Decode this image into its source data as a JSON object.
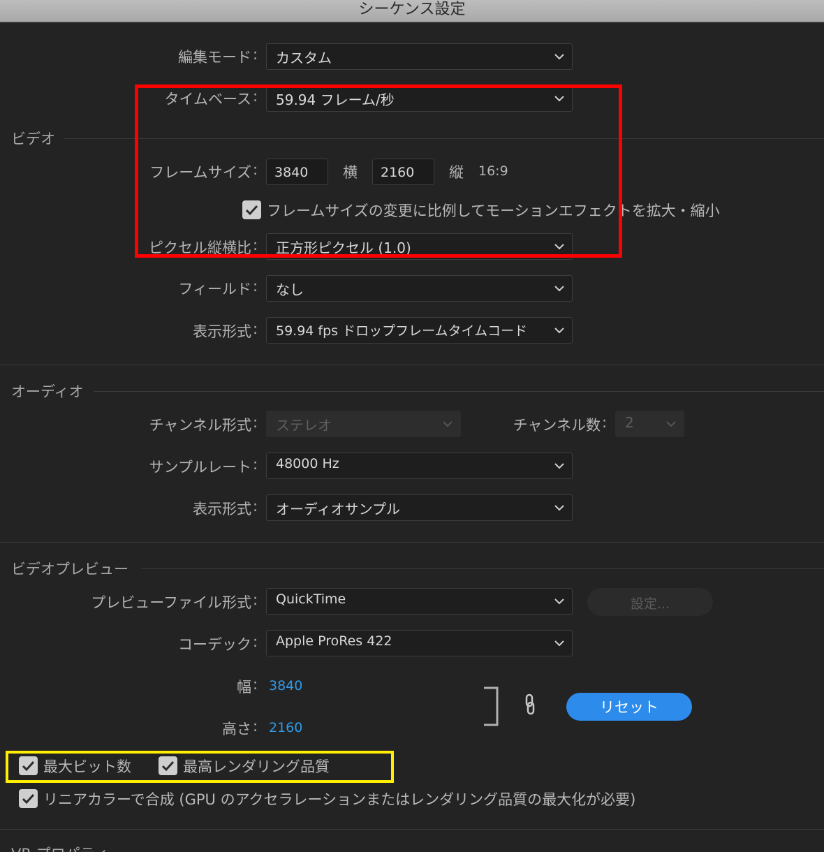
{
  "window": {
    "title": "シーケンス設定"
  },
  "edit_mode": {
    "label": "編集モード",
    "value": "カスタム"
  },
  "timebase": {
    "label": "タイムベース",
    "value": "59.94  フレーム/秒"
  },
  "video": {
    "section_title": "ビデオ",
    "frame_size": {
      "label": "フレームサイズ",
      "width": "3840",
      "width_label": "横",
      "height": "2160",
      "height_label": "縦",
      "aspect": "16:9"
    },
    "scale_motion": {
      "label": "フレームサイズの変更に比例してモーションエフェクトを拡大・縮小",
      "checked": true
    },
    "pixel_aspect": {
      "label": "ピクセル縦横比",
      "value": "正方形ピクセル (1.0)"
    },
    "fields": {
      "label": "フィールド",
      "value": "なし"
    },
    "display_format": {
      "label": "表示形式",
      "value": "59.94 fps ドロップフレームタイムコード"
    }
  },
  "audio": {
    "section_title": "オーディオ",
    "channel_format": {
      "label": "チャンネル形式",
      "value": "ステレオ"
    },
    "channel_count": {
      "label": "チャンネル数",
      "value": "2"
    },
    "sample_rate": {
      "label": "サンプルレート",
      "value": "48000 Hz"
    },
    "display_format": {
      "label": "表示形式",
      "value": "オーディオサンプル"
    }
  },
  "video_preview": {
    "section_title": "ビデオプレビュー",
    "file_format": {
      "label": "プレビューファイル形式",
      "value": "QuickTime"
    },
    "settings_button": "設定...",
    "codec": {
      "label": "コーデック",
      "value": "Apple ProRes 422"
    },
    "width": {
      "label": "幅",
      "value": "3840"
    },
    "height": {
      "label": "高さ",
      "value": "2160"
    },
    "reset_button": "リセット"
  },
  "checkboxes": {
    "max_bit_depth": {
      "label": "最大ビット数",
      "checked": true
    },
    "max_render_quality": {
      "label": "最高レンダリング品質",
      "checked": true
    },
    "linear_color": {
      "label": "リニアカラーで合成 (GPU のアクセラレーションまたはレンダリング品質の最大化が必要)",
      "checked": true
    }
  },
  "vr_section": {
    "section_title": "VR プロパティ"
  },
  "colors": {
    "accent_blue": "#2d8ceb",
    "highlight_red": "#ff0000",
    "highlight_yellow": "#ffee00"
  }
}
